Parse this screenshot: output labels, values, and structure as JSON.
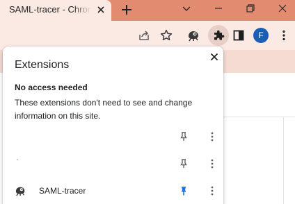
{
  "colors": {
    "frame_accent": "#e38b70",
    "toolbar_bg": "#fbe9e3",
    "pinned_blue": "#1a73e8",
    "avatar_bg": "#1a5fb4"
  },
  "browser": {
    "tab": {
      "title": "SAML-tracer - Chrome",
      "close_icon": "close-icon"
    },
    "new_tab_icon": "plus-icon",
    "window_controls": [
      "chevron-down-icon",
      "minimize-icon",
      "restore-icon",
      "close-icon"
    ],
    "toolbar": {
      "icons": [
        "share-icon",
        "bookmark-star-icon",
        "saml-tracer-icon",
        "extensions-puzzle-icon",
        "side-panel-icon",
        "more-vert-icon"
      ],
      "profile_initial": "F"
    }
  },
  "extensions_popup": {
    "title": "Extensions",
    "section": {
      "heading": "No access needed",
      "description": "These extensions don't need to see and change information on this site."
    },
    "items": [
      {
        "name": "",
        "pinned": false
      },
      {
        "name": "",
        "pinned": false
      },
      {
        "name": "SAML-tracer",
        "pinned": true
      }
    ]
  }
}
